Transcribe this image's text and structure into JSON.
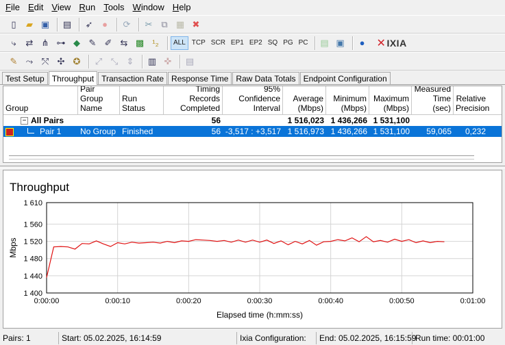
{
  "menu": [
    {
      "u": "F",
      "rest": "ile"
    },
    {
      "u": "E",
      "rest": "dit"
    },
    {
      "u": "V",
      "rest": "iew"
    },
    {
      "u": "R",
      "rest": "un"
    },
    {
      "u": "T",
      "rest": "ools"
    },
    {
      "u": "W",
      "rest": "indow"
    },
    {
      "u": "H",
      "rest": "elp"
    }
  ],
  "toolbar_filters": [
    "ALL",
    "TCP",
    "SCR",
    "EP1",
    "EP2",
    "SQ",
    "PG",
    "PC"
  ],
  "brand": "IXIA",
  "tabs": [
    "Test Setup",
    "Throughput",
    "Transaction Rate",
    "Response Time",
    "Raw Data Totals",
    "Endpoint Configuration"
  ],
  "active_tab": "Throughput",
  "table": {
    "headers": [
      [
        "Group"
      ],
      [
        "Pair Group",
        "Name"
      ],
      [
        "Run Status"
      ],
      [
        "Timing Records",
        "Completed"
      ],
      [
        "95% Confidence",
        "Interval"
      ],
      [
        "Average",
        "(Mbps)"
      ],
      [
        "Minimum",
        "(Mbps)"
      ],
      [
        "Maximum",
        "(Mbps)"
      ],
      [
        "Measured",
        "Time (sec)"
      ],
      [
        "Relative",
        "Precision"
      ]
    ],
    "summary": {
      "group": "All Pairs",
      "records": "56",
      "average": "1 516,023",
      "minimum": "1 436,266",
      "maximum": "1 531,100"
    },
    "pair": {
      "group": "Pair 1",
      "name": "No Group",
      "status": "Finished",
      "records": "56",
      "confidence": "-3,517 : +3,517",
      "average": "1 516,973",
      "minimum": "1 436,266",
      "maximum": "1 531,100",
      "time": "59,065",
      "precision": "0,232"
    }
  },
  "chart_data": {
    "type": "line",
    "title": "Throughput",
    "xlabel": "Elapsed time (h:mm:ss)",
    "ylabel": "Mbps",
    "ylim": [
      1400,
      1610
    ],
    "yticks": [
      "1 610",
      "1 560",
      "1 520",
      "1 480",
      "1 440",
      "1 400"
    ],
    "ytick_values": [
      1610,
      1560,
      1520,
      1480,
      1440,
      1400
    ],
    "xlim": [
      0,
      60
    ],
    "xticks": [
      "0:00:00",
      "0:00:10",
      "0:00:20",
      "0:00:30",
      "0:00:40",
      "0:00:50",
      "0:01:00"
    ],
    "xtick_values": [
      0,
      10,
      20,
      30,
      40,
      50,
      60
    ],
    "grid": true,
    "series": [
      {
        "color": "#e01010",
        "x": [
          0,
          1,
          2,
          3,
          4,
          5,
          6,
          7,
          8,
          9,
          10,
          11,
          12,
          13,
          14,
          15,
          16,
          17,
          18,
          19,
          20,
          21,
          22,
          23,
          24,
          25,
          26,
          27,
          28,
          29,
          30,
          31,
          32,
          33,
          34,
          35,
          36,
          37,
          38,
          39,
          40,
          41,
          42,
          43,
          44,
          45,
          46,
          47,
          48,
          49,
          50,
          51,
          52,
          53,
          54,
          55,
          56
        ],
        "y": [
          1436,
          1507,
          1508,
          1507,
          1502,
          1515,
          1514,
          1521,
          1514,
          1508,
          1517,
          1514,
          1518,
          1516,
          1517,
          1518,
          1516,
          1520,
          1517,
          1521,
          1520,
          1524,
          1523,
          1522,
          1520,
          1522,
          1518,
          1523,
          1518,
          1523,
          1518,
          1523,
          1515,
          1521,
          1512,
          1520,
          1514,
          1522,
          1511,
          1519,
          1520,
          1524,
          1521,
          1528,
          1519,
          1531,
          1519,
          1522,
          1518,
          1525,
          1520,
          1524,
          1517,
          1521,
          1517,
          1520,
          1519
        ]
      }
    ]
  },
  "status": {
    "pairs": "Pairs: 1",
    "start": "Start: 05.02.2025, 16:14:59",
    "config": "Ixia Configuration:",
    "end": "End: 05.02.2025, 16:15:59",
    "runtime": "Run time: 00:01:00"
  }
}
